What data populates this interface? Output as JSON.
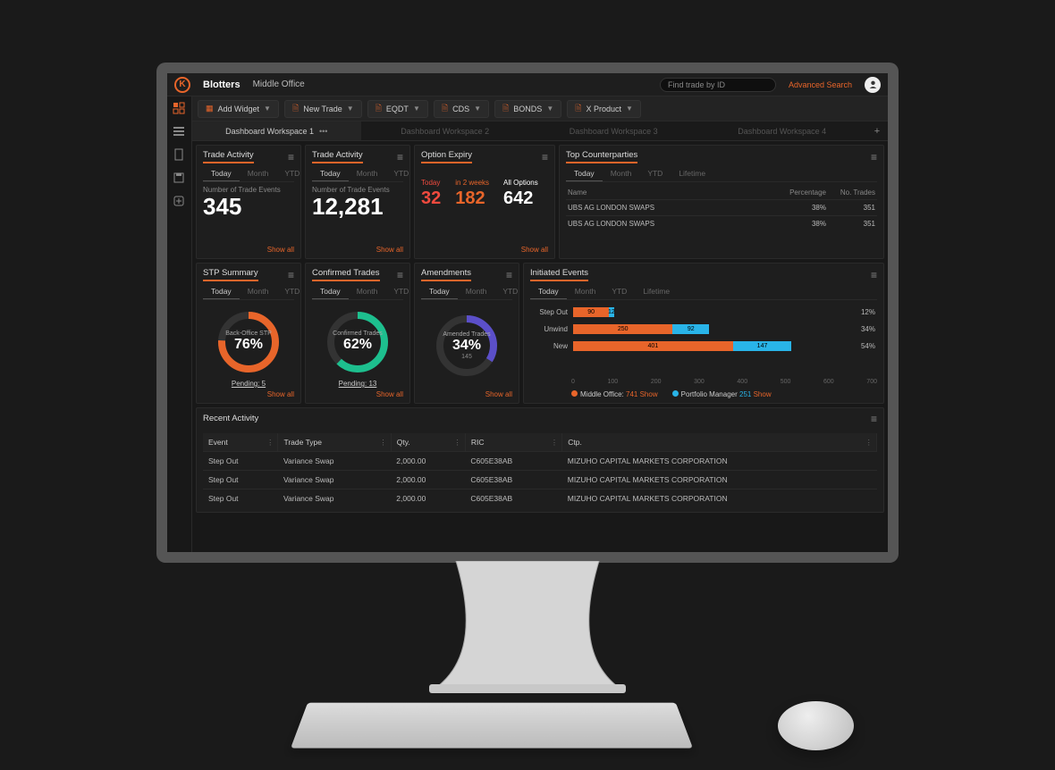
{
  "header": {
    "app_title": "Blotters",
    "subtitle": "Middle Office",
    "search_placeholder": "Find trade by ID",
    "advanced_search": "Advanced Search"
  },
  "toolbar": {
    "add_widget": "Add Widget",
    "new_trade": "New Trade",
    "products": [
      "EQDT",
      "CDS",
      "BONDS",
      "X Product"
    ]
  },
  "workspace_tabs": [
    "Dashboard Workspace 1",
    "Dashboard Workspace 2",
    "Dashboard Workspace 3",
    "Dashboard Workspace 4"
  ],
  "time_tabs": {
    "today": "Today",
    "month": "Month",
    "ytd": "YTD",
    "lifetime": "Lifetime"
  },
  "trade_activity_1": {
    "title": "Trade Activity",
    "label": "Number of Trade Events",
    "value": "345",
    "show_all": "Show all"
  },
  "trade_activity_2": {
    "title": "Trade Activity",
    "label": "Number of Trade Events",
    "value": "12,281",
    "show_all": "Show all"
  },
  "option_expiry": {
    "title": "Option Expiry",
    "cols": [
      {
        "label": "Today",
        "value": "32",
        "cls": "red"
      },
      {
        "label": "in 2 weeks",
        "value": "182",
        "cls": "orange"
      },
      {
        "label": "All Options",
        "value": "642",
        "cls": "white"
      }
    ],
    "show_all": "Show all"
  },
  "top_counterparties": {
    "title": "Top Counterparties",
    "headers": {
      "name": "Name",
      "pct": "Percentage",
      "trades": "No. Trades"
    },
    "rows": [
      {
        "name": "UBS AG LONDON SWAPS",
        "pct": "38%",
        "trades": "351"
      },
      {
        "name": "UBS AG LONDON SWAPS",
        "pct": "38%",
        "trades": "351"
      }
    ]
  },
  "stp_summary": {
    "title": "STP Summary",
    "label": "Back-Office STP",
    "pct": "76%",
    "pending": "Pending: 5",
    "show_all": "Show all"
  },
  "confirmed": {
    "title": "Confirmed Trades",
    "label": "Confirmed Trades",
    "pct": "62%",
    "pending": "Pending: 13",
    "show_all": "Show all"
  },
  "amendments": {
    "title": "Amendments",
    "label": "Amended Trades",
    "pct": "34%",
    "count": "145",
    "show_all": "Show all"
  },
  "initiated": {
    "title": "Initiated Events",
    "rows": [
      {
        "label": "Step Out",
        "v1": 90,
        "v2": 12,
        "pct": "12%"
      },
      {
        "label": "Unwind",
        "v1": 250,
        "v2": 92,
        "pct": "34%"
      },
      {
        "label": "New",
        "v1": 401,
        "v2": 147,
        "pct": "54%"
      }
    ],
    "axis": [
      "0",
      "100",
      "200",
      "300",
      "400",
      "500",
      "600",
      "700"
    ],
    "legend": {
      "a_label": "Middle Office:",
      "a_val": "741",
      "a_show": "Show",
      "b_label": "Portfolio Manager",
      "b_val": "251",
      "b_show": "Show"
    }
  },
  "recent_activity": {
    "title": "Recent Activity",
    "headers": [
      "Event",
      "Trade Type",
      "Qty.",
      "RIC",
      "Ctp."
    ],
    "rows": [
      [
        "Step Out",
        "Variance Swap",
        "2,000.00",
        "C605E38AB",
        "MIZUHO CAPITAL MARKETS CORPORATION"
      ],
      [
        "Step Out",
        "Variance Swap",
        "2,000.00",
        "C605E38AB",
        "MIZUHO CAPITAL MARKETS CORPORATION"
      ],
      [
        "Step Out",
        "Variance Swap",
        "2,000.00",
        "C605E38AB",
        "MIZUHO CAPITAL MARKETS CORPORATION"
      ]
    ]
  },
  "chart_data": [
    {
      "type": "bar",
      "title": "Initiated Events",
      "categories": [
        "Step Out",
        "Unwind",
        "New"
      ],
      "series": [
        {
          "name": "Middle Office",
          "values": [
            90,
            250,
            401
          ]
        },
        {
          "name": "Portfolio Manager",
          "values": [
            12,
            92,
            147
          ]
        }
      ],
      "xlim": [
        0,
        700
      ]
    },
    {
      "type": "pie",
      "title": "Back-Office STP",
      "values": [
        76,
        24
      ]
    },
    {
      "type": "pie",
      "title": "Confirmed Trades",
      "values": [
        62,
        38
      ]
    },
    {
      "type": "pie",
      "title": "Amended Trades",
      "values": [
        34,
        66
      ]
    }
  ]
}
